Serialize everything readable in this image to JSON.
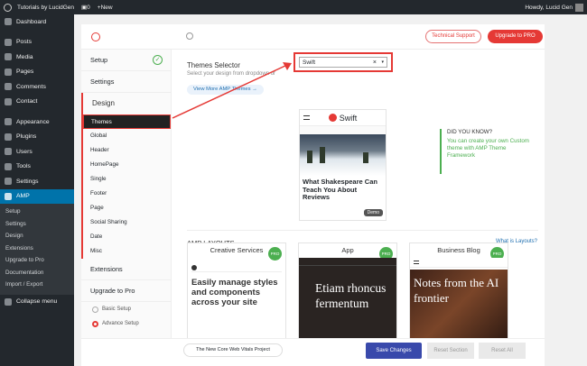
{
  "adminbar": {
    "site": "Tutorials by LucidGen",
    "comments": "0",
    "new": "New",
    "howdy": "Howdy, Lucid Gen"
  },
  "sidebar": {
    "items": [
      "Dashboard",
      "Posts",
      "Media",
      "Pages",
      "Comments",
      "Contact",
      "Appearance",
      "Plugins",
      "Users",
      "Tools",
      "Settings",
      "AMP"
    ],
    "sub": [
      "Setup",
      "Settings",
      "Design",
      "Extensions",
      "Upgrade to Pro",
      "Documentation",
      "Import / Export"
    ],
    "collapse": "Collapse menu"
  },
  "top": {
    "support": "Technical Support",
    "upgrade": "Upgrade to PRO"
  },
  "leftnav": {
    "setup": "Setup",
    "settings": "Settings",
    "design": "Design",
    "design_items": [
      "Themes",
      "Global",
      "Header",
      "HomePage",
      "Single",
      "Footer",
      "Page",
      "Social Sharing",
      "Date",
      "Misc"
    ],
    "extensions": "Extensions",
    "upgrade": "Upgrade to Pro",
    "basic": "Basic Setup",
    "advance": "Advance Setup"
  },
  "themes": {
    "title": "Themes Selector",
    "desc": "Select your design from dropdown or",
    "view_more": "View More AMP Themes →",
    "selected": "Swift",
    "preview_title": "What Shakespeare Can Teach You About Reviews",
    "demo": "Demo"
  },
  "dyk": {
    "heading": "DID YOU KNOW?",
    "link": "You can create your own Custom theme with AMP Theme Framework"
  },
  "layouts": {
    "title": "AMP LAYOUTS",
    "what": "What is Layouts?",
    "cards": [
      {
        "name": "Creative Services",
        "pro": "PRO",
        "headline": "Easily manage styles and components across your site"
      },
      {
        "name": "App",
        "pro": "PRO",
        "headline": "Etiam rhoncus fermentum"
      },
      {
        "name": "Business Blog",
        "pro": "PRO",
        "headline": "Notes from the AI frontier"
      }
    ]
  },
  "footer": {
    "link": "The New Core Web Vitals Project",
    "save": "Save Changes",
    "reset": "Reset Section",
    "reset_all": "Reset All"
  }
}
